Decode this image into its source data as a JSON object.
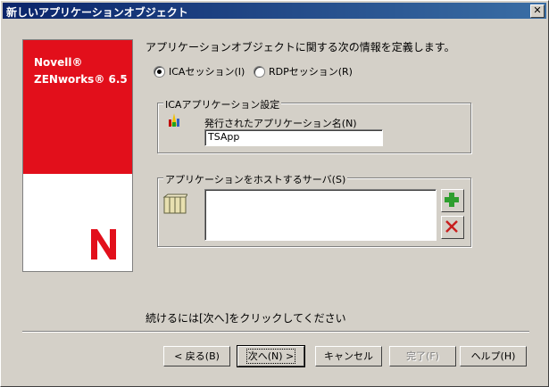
{
  "window": {
    "title": "新しいアプリケーションオブジェクト",
    "close_label": "✕"
  },
  "banner": {
    "line1": "Novell®",
    "line2": "ZENworks® 6.5"
  },
  "instruction": "アプリケーションオブジェクトに関する次の情報を定義します。",
  "session": {
    "ica_label": "ICAセッション(I)",
    "rdp_label": "RDPセッション(R)",
    "selected": "ica"
  },
  "ica_group": {
    "label": "ICAアプリケーション設定",
    "name_label": "発行されたアプリケーション名(N)",
    "name_value": "TSApp"
  },
  "server_group": {
    "label": "アプリケーションをホストするサーバ(S)"
  },
  "hint": "続けるには[次へ]をクリックしてください",
  "buttons": {
    "back": "< 戻る(B)",
    "next": "次へ(N) >",
    "cancel": "キャンセル",
    "finish": "完了(F)",
    "help": "ヘルプ(H)"
  },
  "colors": {
    "banner_red": "#e20f1b",
    "title_blue": "#0a246a",
    "add_green": "#2e9e2e",
    "delete_red": "#c81e1e"
  }
}
